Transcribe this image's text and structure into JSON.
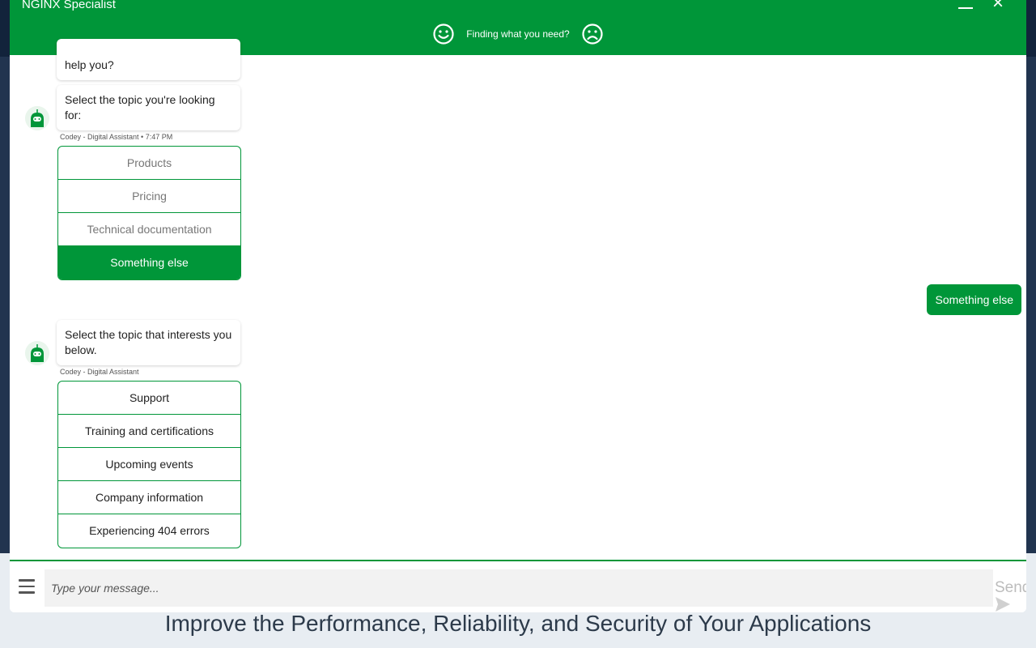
{
  "background": {
    "tagline": "Improve the Performance, Reliability, and Security of Your Applications"
  },
  "chat": {
    "title": "NGINX Specialist",
    "feedback_prompt": "Finding what you need?",
    "messages": {
      "partial_bubble": "help you?",
      "topic_prompt": "Select the topic you're looking for:",
      "topic_meta": "Codey - Digital Assistant • 7:47 PM",
      "topic_options": [
        "Products",
        "Pricing",
        "Technical documentation",
        "Something else"
      ],
      "user_reply": "Something else",
      "interest_prompt": "Select the topic that interests you below.",
      "interest_meta": "Codey - Digital Assistant",
      "interest_options": [
        "Support",
        "Training and certifications",
        "Upcoming events",
        "Company information",
        "Experiencing 404 errors"
      ]
    },
    "composer": {
      "placeholder": "Type your message...",
      "send_label": "Send"
    }
  },
  "colors": {
    "brand_green": "#009639",
    "background_dark": "#21344f"
  },
  "icons": [
    "smile-icon",
    "frown-icon",
    "close-icon",
    "minimize-icon",
    "menu-icon",
    "send-icon",
    "bot-avatar"
  ]
}
